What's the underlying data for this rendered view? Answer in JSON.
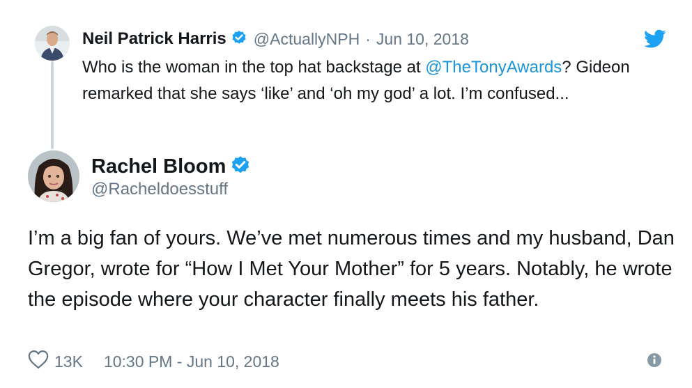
{
  "reply": {
    "name": "Neil Patrick Harris",
    "handle": "@ActuallyNPH",
    "separator": "·",
    "date": "Jun 10, 2018",
    "text_before": "Who is the woman in the top hat backstage at ",
    "mention": "@TheTonyAwards",
    "text_after": "? Gideon remarked that she says ‘like’ and ‘oh my god’ a lot. I’m confused..."
  },
  "tweet": {
    "name": "Rachel Bloom",
    "handle": "@Racheldoesstuff",
    "text": "I’m a big fan of yours. We’ve met numerous times and my husband, Dan Gregor, wrote for “How I Met Your Mother” for 5 years. Notably, he wrote the episode where your character finally meets his father.",
    "likes": "13K",
    "timestamp": "10:30 PM - Jun 10, 2018"
  },
  "colors": {
    "link": "#1b95e0",
    "verified": "#1da1f2",
    "muted": "#657786",
    "text": "#14171a"
  },
  "icons": [
    "verified-badge-icon",
    "twitter-bird-icon",
    "heart-icon",
    "info-icon"
  ]
}
